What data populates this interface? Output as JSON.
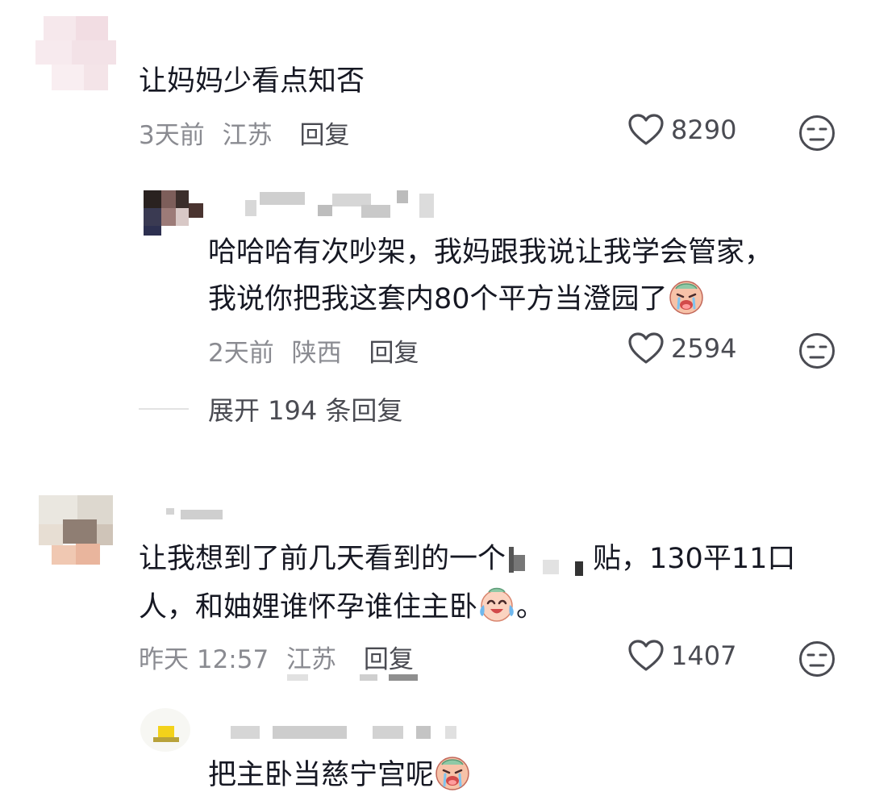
{
  "comments": [
    {
      "text": "让妈妈少看点知否",
      "time": "3天前",
      "location": "江苏",
      "reply_label": "回复",
      "likes": "8290"
    },
    {
      "text_line1": "哈哈哈有次吵架，我妈跟我说让我学会管家，",
      "text_line2": "我说你把我这套内80个平方当澄园了",
      "time": "2天前",
      "location": "陕西",
      "reply_label": "回复",
      "likes": "2594"
    },
    {
      "text_line1_pre": "让我想到了前几天看到的一个",
      "text_line1_post": "贴，130平11口",
      "text_line2_pre": "人，和妯娌谁怀孕谁住主卧",
      "text_line2_post": "。",
      "time": "昨天 12:57",
      "location": "江苏",
      "reply_label": "回复",
      "likes": "1407"
    },
    {
      "text": "把主卧当慈宁宫呢"
    }
  ],
  "expand_replies": "展开 194 条回复",
  "icons": {
    "like": "heart-outline-icon",
    "dislike": "meh-face-icon",
    "emoji_cry": "crying-face-emoji",
    "emoji_laugh": "laughing-tears-emoji"
  },
  "colors": {
    "text": "#161823",
    "meta": "#8a8b91",
    "action": "#4a4b52"
  }
}
